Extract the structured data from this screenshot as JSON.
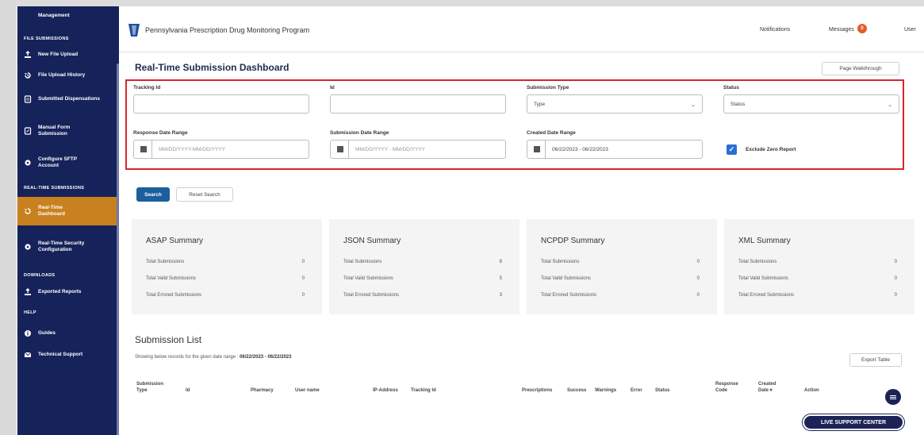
{
  "header": {
    "app_title": "Pennsylvania Prescription Drug Monitoring Program",
    "notifications": "Notifications",
    "messages": "Messages",
    "messages_badge": "0",
    "user": "User"
  },
  "sidebar": {
    "top_item": "Management",
    "sections": [
      {
        "heading": "FILE SUBMISSIONS"
      },
      {
        "heading": "REAL-TIME SUBMISSIONS"
      },
      {
        "heading": "DOWNLOADS"
      },
      {
        "heading": "HELP"
      }
    ],
    "items": [
      {
        "label": "New File Upload",
        "icon": "upload-icon"
      },
      {
        "label": "File Upload History",
        "icon": "history-icon"
      },
      {
        "label": "Submitted Dispensations",
        "icon": "document-icon"
      },
      {
        "label": "Manual Form Submission",
        "icon": "edit-icon"
      },
      {
        "label": "Configure SFTP Account",
        "icon": "gear-icon"
      },
      {
        "label": "Real-Time Dashboard",
        "icon": "history-icon",
        "active": true
      },
      {
        "label": "Real-Time Security Configuration",
        "icon": "gear-icon"
      },
      {
        "label": "Exported Reports",
        "icon": "upload-icon"
      },
      {
        "label": "Guides",
        "icon": "info-icon"
      },
      {
        "label": "Technical Support",
        "icon": "mail-icon"
      }
    ]
  },
  "page": {
    "title": "Real-Time Submission Dashboard",
    "walkthrough": "Page Walkthrough"
  },
  "filters": {
    "tracking_id": {
      "label": "Tracking Id",
      "value": ""
    },
    "id": {
      "label": "Id",
      "value": ""
    },
    "submission_type": {
      "label": "Submission Type",
      "value": "Type"
    },
    "status": {
      "label": "Status",
      "value": "Status"
    },
    "response_date": {
      "label": "Response Date Range",
      "placeholder": "MM/DD/YYYY-MM/DD/YYYY"
    },
    "submission_date": {
      "label": "Submission Date Range",
      "placeholder": "MM/DD/YYYY - MM/DD/YYYY"
    },
    "created_date": {
      "label": "Created Date Range",
      "value": "06/22/2023 - 06/22/2023"
    },
    "exclude_zero": {
      "label": "Exclude Zero Report",
      "checked": true
    }
  },
  "actions": {
    "search": "Search",
    "reset": "Reset Search"
  },
  "summaries": [
    {
      "title": "ASAP Summary",
      "rows": [
        {
          "label": "Total Submissions",
          "value": "0"
        },
        {
          "label": "Total Valid Submissions",
          "value": "0"
        },
        {
          "label": "Total Errored Submissions",
          "value": "0"
        }
      ]
    },
    {
      "title": "JSON Summary",
      "rows": [
        {
          "label": "Total Submissions",
          "value": "8"
        },
        {
          "label": "Total Valid Submissions",
          "value": "5"
        },
        {
          "label": "Total Errored Submissions",
          "value": "3"
        }
      ]
    },
    {
      "title": "NCPDP Summary",
      "rows": [
        {
          "label": "Total Submissions",
          "value": "0"
        },
        {
          "label": "Total Valid Submissions",
          "value": "0"
        },
        {
          "label": "Total Errored Submissions",
          "value": "0"
        }
      ]
    },
    {
      "title": "XML Summary",
      "rows": [
        {
          "label": "Total Submissions",
          "value": "0"
        },
        {
          "label": "Total Valid Submissions",
          "value": "0"
        },
        {
          "label": "Total Errored Submissions",
          "value": "0"
        }
      ]
    }
  ],
  "submission_list": {
    "title": "Submission List",
    "range_prefix": "Showing below records for the given date range : ",
    "range_value": "06/22/2023 - 06/22/2023",
    "export": "Export Table",
    "columns": [
      "Submission Type",
      "Id",
      "Pharmacy",
      "User name",
      "IP-Address",
      "Tracking Id",
      "Prescriptions",
      "Success",
      "Warnings",
      "Error",
      "Status",
      "Response Code",
      "Created Date ▾",
      "Action"
    ]
  },
  "support": {
    "live": "LIVE SUPPORT CENTER"
  },
  "colors": {
    "sidebar": "#16225a",
    "active": "#c9801f",
    "highlight_border": "#d7262e",
    "primary": "#1b5f9e"
  }
}
